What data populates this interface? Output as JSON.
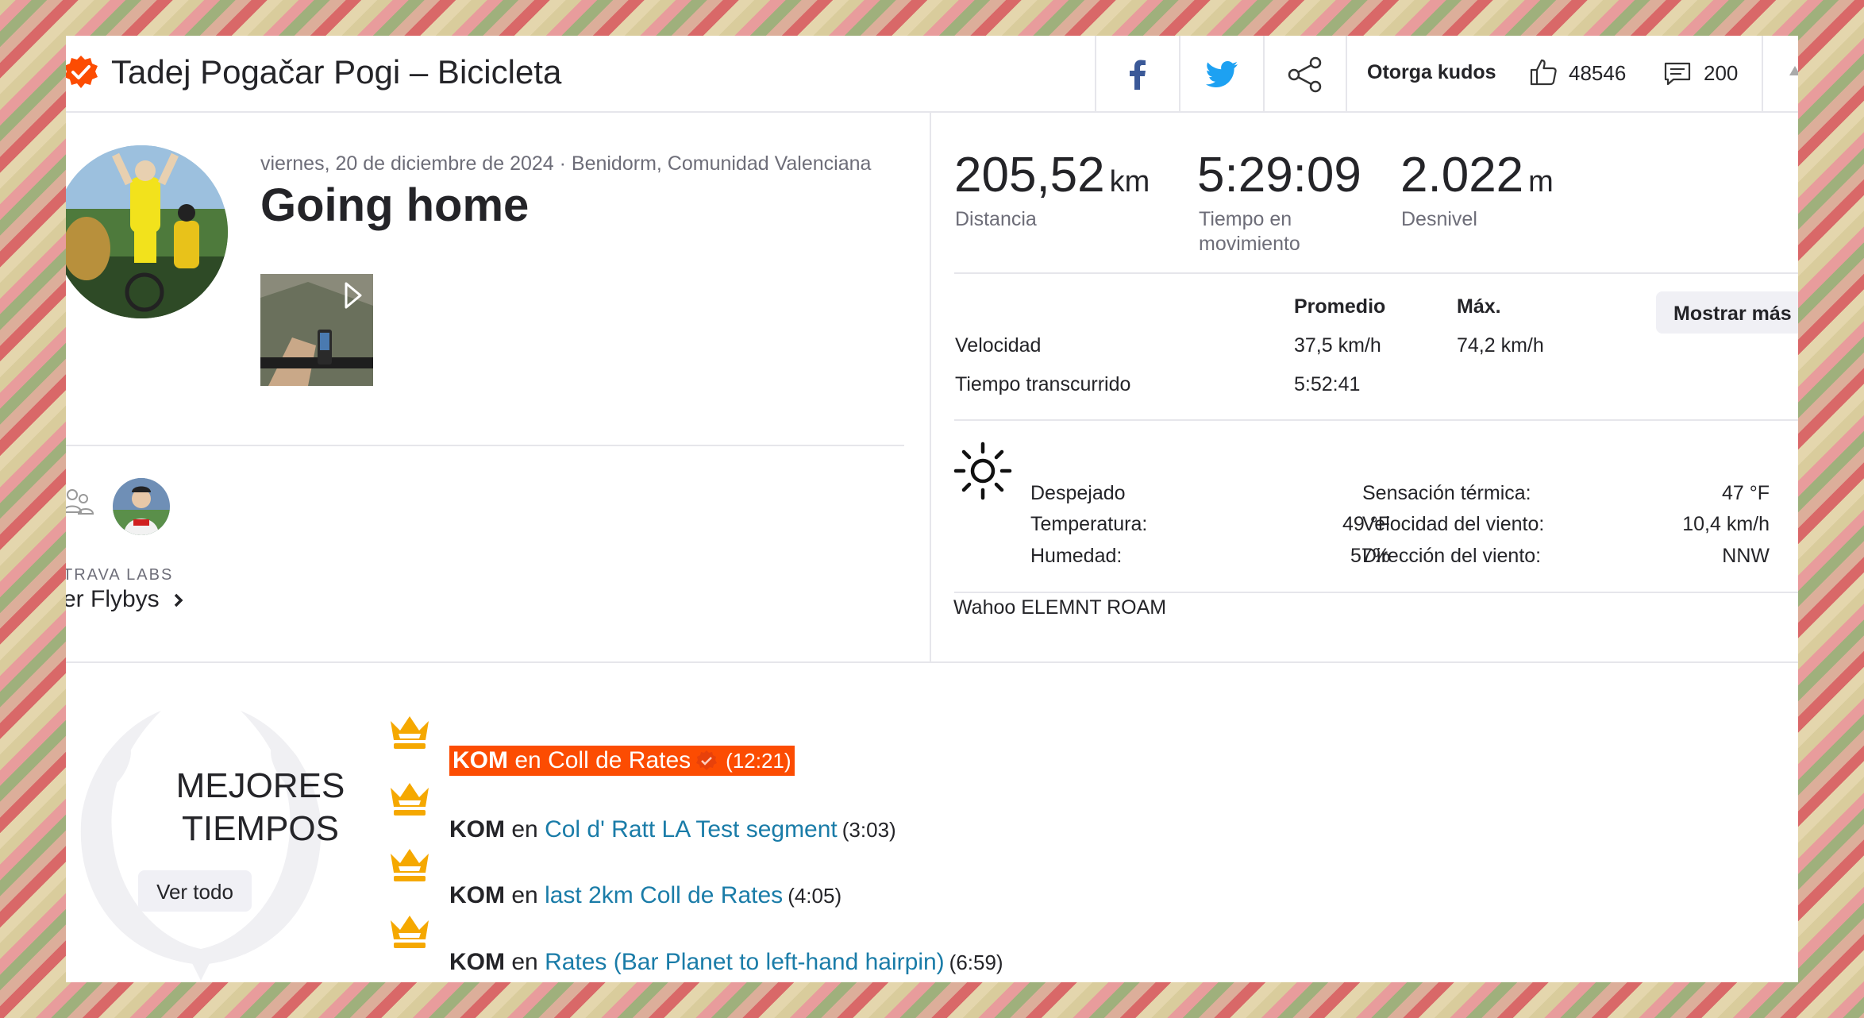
{
  "header": {
    "athlete_title": "Tadej Pogačar Pogi – Bicicleta",
    "share": {
      "facebook_icon": "facebook-icon",
      "twitter_icon": "twitter-icon",
      "share_icon": "share-icon"
    },
    "kudos_label": "Otorga kudos",
    "kudos_count": "48546",
    "comment_count": "200",
    "colors": {
      "brand": "#fc4c02",
      "facebook": "#3b5998",
      "twitter": "#1da1f2"
    }
  },
  "activity": {
    "meta": "viernes, 20 de diciembre de 2024 · Benidorm, Comunidad Valenciana",
    "title": "Going home"
  },
  "flyby": {
    "labs": "TRAVA LABS",
    "link": "er Flybys"
  },
  "stats": {
    "distance": {
      "value": "205,52",
      "unit": "km",
      "label": "Distancia"
    },
    "moving_time": {
      "value": "5:29:09",
      "label": "Tiempo en movimiento"
    },
    "elevation": {
      "value": "2.022",
      "unit": "m",
      "label": "Desnivel"
    }
  },
  "table": {
    "col_avg": "Promedio",
    "col_max": "Máx.",
    "more_button": "Mostrar más",
    "rows": [
      {
        "label": "Velocidad",
        "avg": "37,5 km/h",
        "max": "74,2 km/h"
      },
      {
        "label": "Tiempo transcurrido",
        "avg": "5:52:41",
        "max": ""
      }
    ]
  },
  "weather": {
    "icon": "sun-icon",
    "condition": "Despejado",
    "temperature_label": "Temperatura:",
    "temperature": "49 °F",
    "humidity_label": "Humedad:",
    "humidity": "57%",
    "feels_like_label": "Sensación térmica:",
    "feels_like": "47 °F",
    "wind_speed_label": "Velocidad del viento:",
    "wind_speed": "10,4 km/h",
    "wind_dir_label": "Dirección del viento:",
    "wind_dir": "NNW"
  },
  "device": "Wahoo ELEMNT ROAM",
  "achievements": {
    "title_line1": "MEJORES",
    "title_line2": "TIEMPOS",
    "view_all": "Ver todo",
    "items": [
      {
        "kom": "KOM",
        "en": "en",
        "segment": "Coll de Rates",
        "time": "(12:21)"
      },
      {
        "kom": "KOM",
        "en": "en",
        "segment": "Col d' Ratt LA Test segment",
        "time": "(3:03)"
      },
      {
        "kom": "KOM",
        "en": "en",
        "segment": "last 2km Coll de Rates",
        "time": "(4:05)"
      },
      {
        "kom": "KOM",
        "en": "en",
        "segment": "Rates (Bar Planet to left-hand hairpin)",
        "time": "(6:59)"
      }
    ]
  }
}
